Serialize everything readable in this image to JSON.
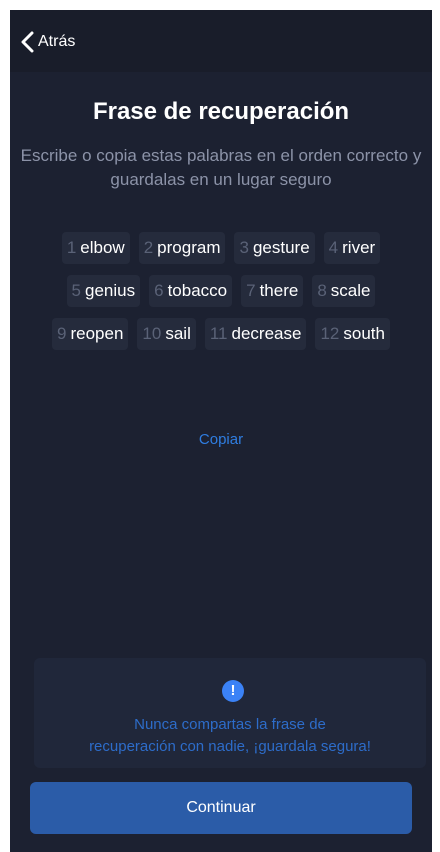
{
  "header": {
    "back_label": "Atrás"
  },
  "title": "Frase de recuperación",
  "subtitle": "Escribe o copia estas palabras en el orden correcto y guardalas en un lugar seguro",
  "words": [
    {
      "num": "1",
      "word": "elbow"
    },
    {
      "num": "2",
      "word": "program"
    },
    {
      "num": "3",
      "word": "gesture"
    },
    {
      "num": "4",
      "word": "river"
    },
    {
      "num": "5",
      "word": "genius"
    },
    {
      "num": "6",
      "word": "tobacco"
    },
    {
      "num": "7",
      "word": "there"
    },
    {
      "num": "8",
      "word": "scale"
    },
    {
      "num": "9",
      "word": "reopen"
    },
    {
      "num": "10",
      "word": "sail"
    },
    {
      "num": "11",
      "word": "decrease"
    },
    {
      "num": "12",
      "word": "south"
    }
  ],
  "copy_label": "Copiar",
  "warning": {
    "icon": "exclamation-icon",
    "icon_glyph": "!",
    "line1": "Nunca compartas la frase de",
    "line2": "recuperación con nadie, ¡guardala segura!"
  },
  "continue_label": "Continuar",
  "colors": {
    "background": "#1c2131",
    "accent": "#2f7de1",
    "button": "#2b5ca8"
  }
}
